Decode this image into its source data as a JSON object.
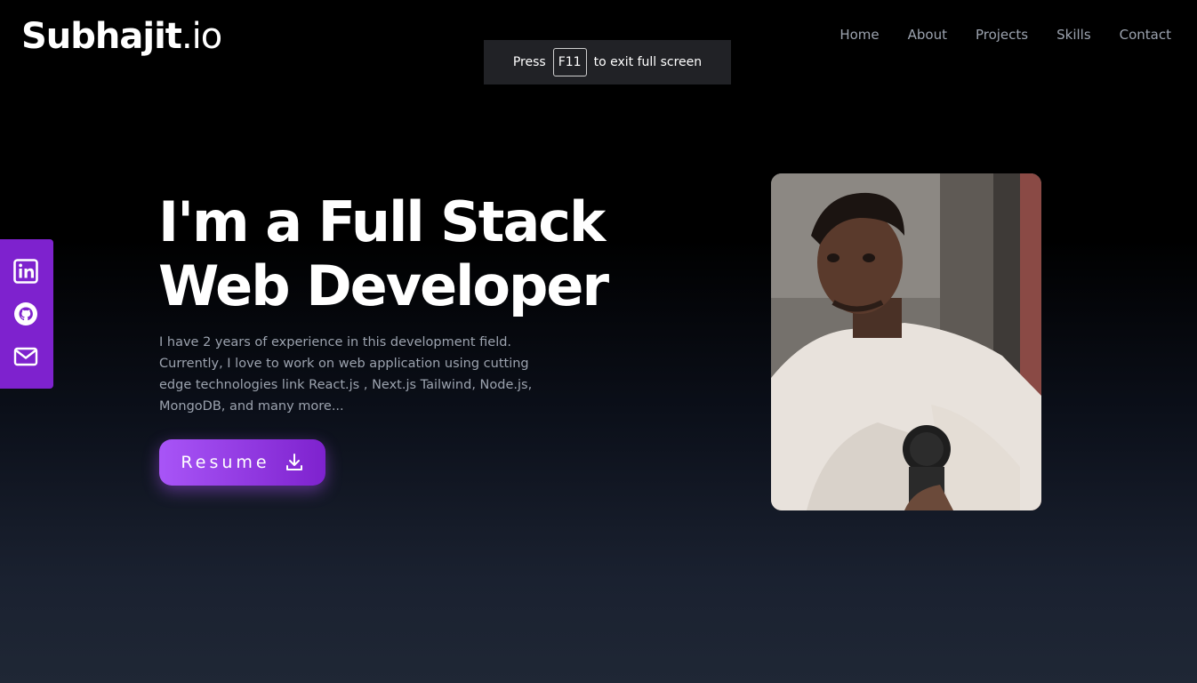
{
  "logo": {
    "bold": "Subhajit",
    "light": ".io"
  },
  "nav": {
    "items": [
      {
        "label": "Home"
      },
      {
        "label": "About"
      },
      {
        "label": "Projects"
      },
      {
        "label": "Skills"
      },
      {
        "label": "Contact"
      }
    ]
  },
  "fullscreen_toast": {
    "prefix": "Press",
    "key": "F11",
    "suffix": "to exit full screen"
  },
  "social": {
    "icons": [
      "linkedin-icon",
      "github-icon",
      "mail-icon"
    ],
    "bg_color": "#7e22ce"
  },
  "hero": {
    "title": "I'm a Full Stack Web Developer",
    "description": "I have 2 years of experience in this development field. Currently, I love to work on web application using cutting edge technologies link React.js , Next.js Tailwind, Node.js, MongoDB, and many more...",
    "resume_label": "Resume",
    "resume_icon": "download-icon"
  },
  "colors": {
    "accent": "#a855f7",
    "accent_dark": "#7e22ce",
    "text_muted": "#9ca3af"
  }
}
